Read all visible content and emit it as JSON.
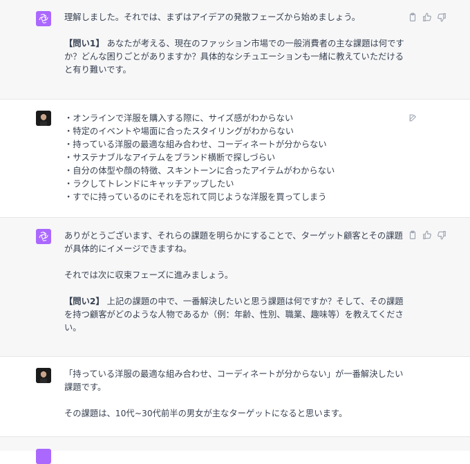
{
  "messages": [
    {
      "role": "assistant",
      "paragraphs": [
        "理解しました。それでは、まずはアイデアの発散フェーズから始めましょう。",
        "",
        {
          "prefix": "【問い1】",
          "text": " あなたが考える、現在のファッション市場での一般消費者の主な課題は何ですか？どんな困りごとがありますか？具体的なシチュエーションも一緒に教えていただけると有り難いです。"
        }
      ]
    },
    {
      "role": "user",
      "bullets": [
        "・オンラインで洋服を購入する際に、サイズ感がわからない",
        "・特定のイベントや場面に合ったスタイリングがわからない",
        "・持っている洋服の最適な組み合わせ、コーディネートが分からない",
        "・サステナブルなアイテムをブランド横断で探しづらい",
        "・自分の体型や顔の特徴、スキントーンに合ったアイテムがわからない",
        "・ラクしてトレンドにキャッチアップしたい",
        "・すでに持っているのにそれを忘れて同じような洋服を買ってしまう"
      ]
    },
    {
      "role": "assistant",
      "paragraphs": [
        "ありがとうございます、それらの課題を明らかにすることで、ターゲット顧客とその課題が具体的にイメージできますね。",
        "それでは次に収束フェーズに進みましょう。",
        {
          "prefix": "【問い2】",
          "text": " 上記の課題の中で、一番解決したいと思う課題は何ですか？そして、その課題を持つ顧客がどのような人物であるか（例：年齢、性別、職業、趣味等）を教えてください。"
        }
      ]
    },
    {
      "role": "user",
      "paragraphs": [
        "「持っている洋服の最適な組み合わせ、コーディネートが分からない」が一番解決したい課題です。",
        "その課題は、10代~30代前半の男女が主なターゲットになると思います。"
      ]
    }
  ],
  "icons": {
    "assistant_avatar": "openai-logo-icon",
    "copy": "clipboard-icon",
    "like": "thumbs-up-icon",
    "dislike": "thumbs-down-icon",
    "edit": "edit-icon"
  },
  "colors": {
    "assistant_bg": "#f7f7f8",
    "user_bg": "#ffffff",
    "avatar_purple": "#ab68ff",
    "text": "#374151"
  }
}
